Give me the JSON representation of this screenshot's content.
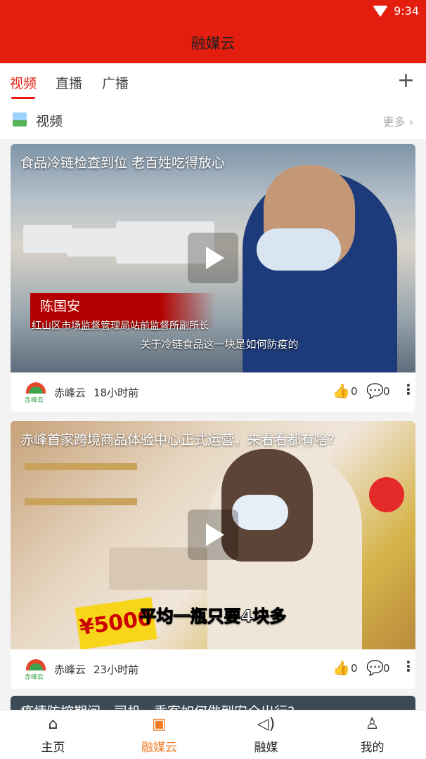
{
  "status_bar": {
    "time": "9:34"
  },
  "app_title": "融媒云",
  "tabs": [
    {
      "label": "视频",
      "active": true
    },
    {
      "label": "直播",
      "active": false
    },
    {
      "label": "广播",
      "active": false
    }
  ],
  "add_icon": "plus-icon",
  "section": {
    "title": "视频",
    "more": "更多 ›"
  },
  "videos": [
    {
      "title": "食品冷链检查到位  老百姓吃得放心",
      "overlay_name": "陈国安",
      "overlay_role": "红山区市场监督管理局站前监督所副所长",
      "overlay_subtitle": "关于冷链食品这一块是如何防疫的",
      "source": "赤峰云",
      "time": "18小时前",
      "likes": "0",
      "comments": "0"
    },
    {
      "title": "赤峰首家跨境商品体验中心正式运营，来看看都有啥?",
      "overlay_subtitle": "平均一瓶只要4块多",
      "overlay_price": "¥5000",
      "source": "赤峰云",
      "time": "23小时前",
      "likes": "0",
      "comments": "0"
    },
    {
      "title": "疫情防控期间，司机、乘客如何做到安全出行?"
    }
  ],
  "logo_text": "赤峰云",
  "bottom_nav": [
    {
      "label": "主页",
      "icon": "home-icon",
      "active": false
    },
    {
      "label": "融媒云",
      "icon": "tv-icon",
      "active": true
    },
    {
      "label": "融媒",
      "icon": "speaker-icon",
      "active": false
    },
    {
      "label": "我的",
      "icon": "person-icon",
      "active": false
    }
  ],
  "colors": {
    "brand": "#e31e0f",
    "nav_active": "#f07b23"
  }
}
